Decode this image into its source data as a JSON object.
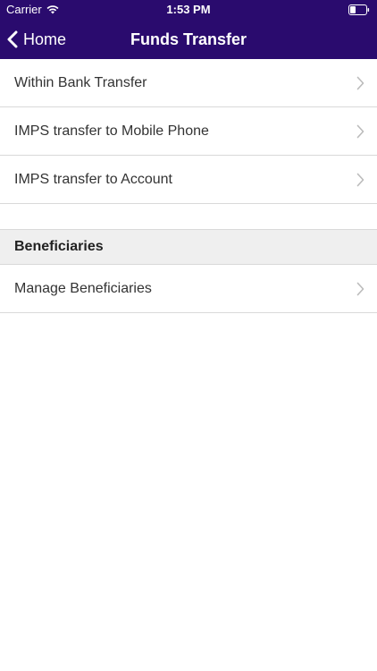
{
  "status_bar": {
    "carrier": "Carrier",
    "time": "1:53 PM",
    "icons": [
      "wifi-icon",
      "battery-icon"
    ]
  },
  "nav": {
    "back_label": "Home",
    "title": "Funds Transfer",
    "icons": [
      "chevron-left-icon"
    ]
  },
  "transfer_items": [
    {
      "label": "Within Bank Transfer"
    },
    {
      "label": "IMPS transfer to Mobile Phone"
    },
    {
      "label": "IMPS transfer to Account"
    }
  ],
  "beneficiaries_section": {
    "header": "Beneficiaries",
    "items": [
      {
        "label": "Manage Beneficiaries"
      }
    ]
  },
  "colors": {
    "header_background": "#2a0b6e",
    "header_text": "#ffffff",
    "section_background": "#efefef",
    "separator": "#d9d9d9",
    "chevron": "#bbbbbb"
  }
}
